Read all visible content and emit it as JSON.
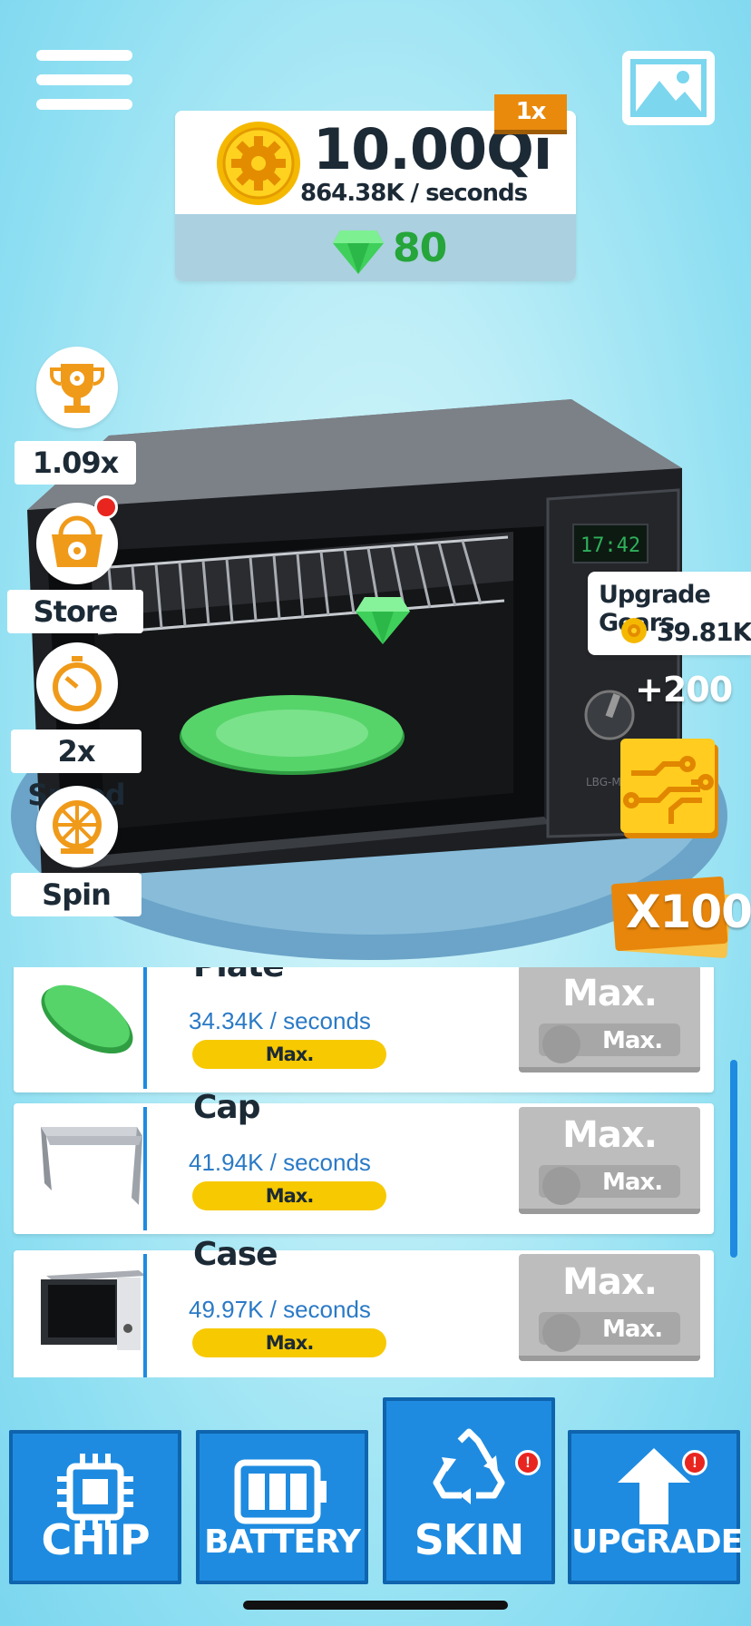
{
  "topbar": {
    "menu_icon": "hamburger-menu-icon",
    "gallery_icon": "image-gallery-icon"
  },
  "currency": {
    "coins": "10.00Qi",
    "rate": "864.38K / seconds",
    "multiplier": "1x",
    "gems": "80"
  },
  "side_actions": [
    {
      "name": "trophy",
      "icon": "trophy-gear-icon",
      "label": "1.09x"
    },
    {
      "name": "store",
      "icon": "basket-gear-icon",
      "label": "Store",
      "notification": true
    },
    {
      "name": "speed",
      "icon": "stopwatch-icon",
      "label": "2x Speed"
    },
    {
      "name": "spin",
      "icon": "wheel-icon",
      "label": "Spin"
    }
  ],
  "scene": {
    "clock": "17:42",
    "brand": "LBG-MICRO",
    "upgrade_gears_title": "Upgrade Gears",
    "upgrade_gears_cost": "39.81K",
    "bonus_text": "+200",
    "multiplier_card": "X100"
  },
  "parts": [
    {
      "name": "Plate",
      "rate": "34.34K / seconds",
      "level": "Max.",
      "button_title": "Max.",
      "button_sub": "Max."
    },
    {
      "name": "Cap",
      "rate": "41.94K / seconds",
      "level": "Max.",
      "button_title": "Max.",
      "button_sub": "Max."
    },
    {
      "name": "Case",
      "rate": "49.97K / seconds",
      "level": "Max.",
      "button_title": "Max.",
      "button_sub": "Max."
    }
  ],
  "nav": [
    {
      "label": "CHIP",
      "icon": "chip-icon"
    },
    {
      "label": "BATTERY",
      "icon": "battery-icon"
    },
    {
      "label": "SKIN",
      "icon": "recycle-icon",
      "alert": "!"
    },
    {
      "label": "UPGRADE",
      "icon": "arrow-up-icon",
      "alert": "!"
    }
  ],
  "colors": {
    "accent_blue": "#1e8be0",
    "coin_gold": "#f5b800",
    "gem_green": "#25a53a",
    "orange": "#e98a0d"
  }
}
